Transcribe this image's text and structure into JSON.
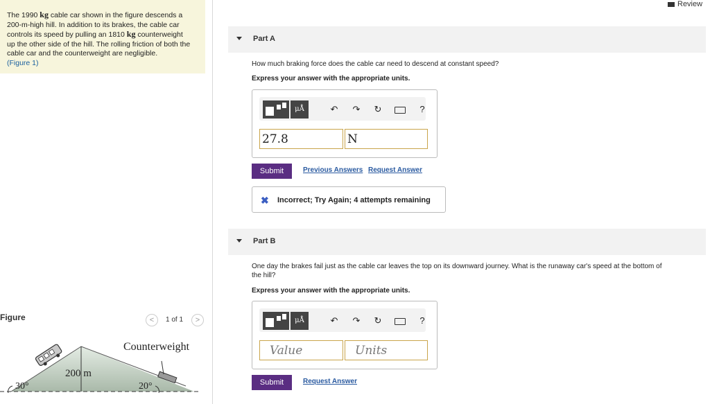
{
  "problem": {
    "line1_a": "The 1990 ",
    "line1_kg": "kg",
    "line1_b": " cable car shown in the figure descends a",
    "line2": "200-m-high hill. In addition to its brakes, the cable car",
    "line3_a": "controls its speed by pulling an 1810 ",
    "line3_kg": "kg",
    "line3_b": " counterweight",
    "line4": "up the other side of the hill. The rolling friction of both the",
    "line5": "cable car and the counterweight are negligible.",
    "figure_link": "(Figure 1)"
  },
  "review_label": "Review",
  "part_a": {
    "title": "Part A",
    "question": "How much braking force does the cable car need to descend at constant speed?",
    "instruction": "Express your answer with the appropriate units.",
    "value": "27.8",
    "units": "N",
    "submit": "Submit",
    "previous_answers": "Previous Answers",
    "request_answer": "Request Answer",
    "feedback": "Incorrect; Try Again; 4 attempts remaining",
    "feedback_icon": "x-mark-icon"
  },
  "part_b": {
    "title": "Part B",
    "question_1": "One day the brakes fail just as the cable car leaves the top on its downward journey. What is the runaway car's speed at the bottom of",
    "question_2": "the hill?",
    "instruction": "Express your answer with the appropriate units.",
    "value_placeholder": "Value",
    "units_placeholder": "Units",
    "submit": "Submit",
    "request_answer": "Request Answer"
  },
  "toolbar": {
    "mu_a": "μÅ",
    "undo": "↶",
    "redo": "↷",
    "reset": "↻",
    "help": "?"
  },
  "figure": {
    "label": "Figure",
    "pager": "1 of 1",
    "counterweight": "Counterweight",
    "height": "200 m",
    "angle_left": "30°",
    "angle_right": "20°"
  },
  "colors": {
    "submit_bg": "#5a2d82",
    "problem_bg": "#f7f5dc",
    "input_border": "#c9a44a"
  }
}
